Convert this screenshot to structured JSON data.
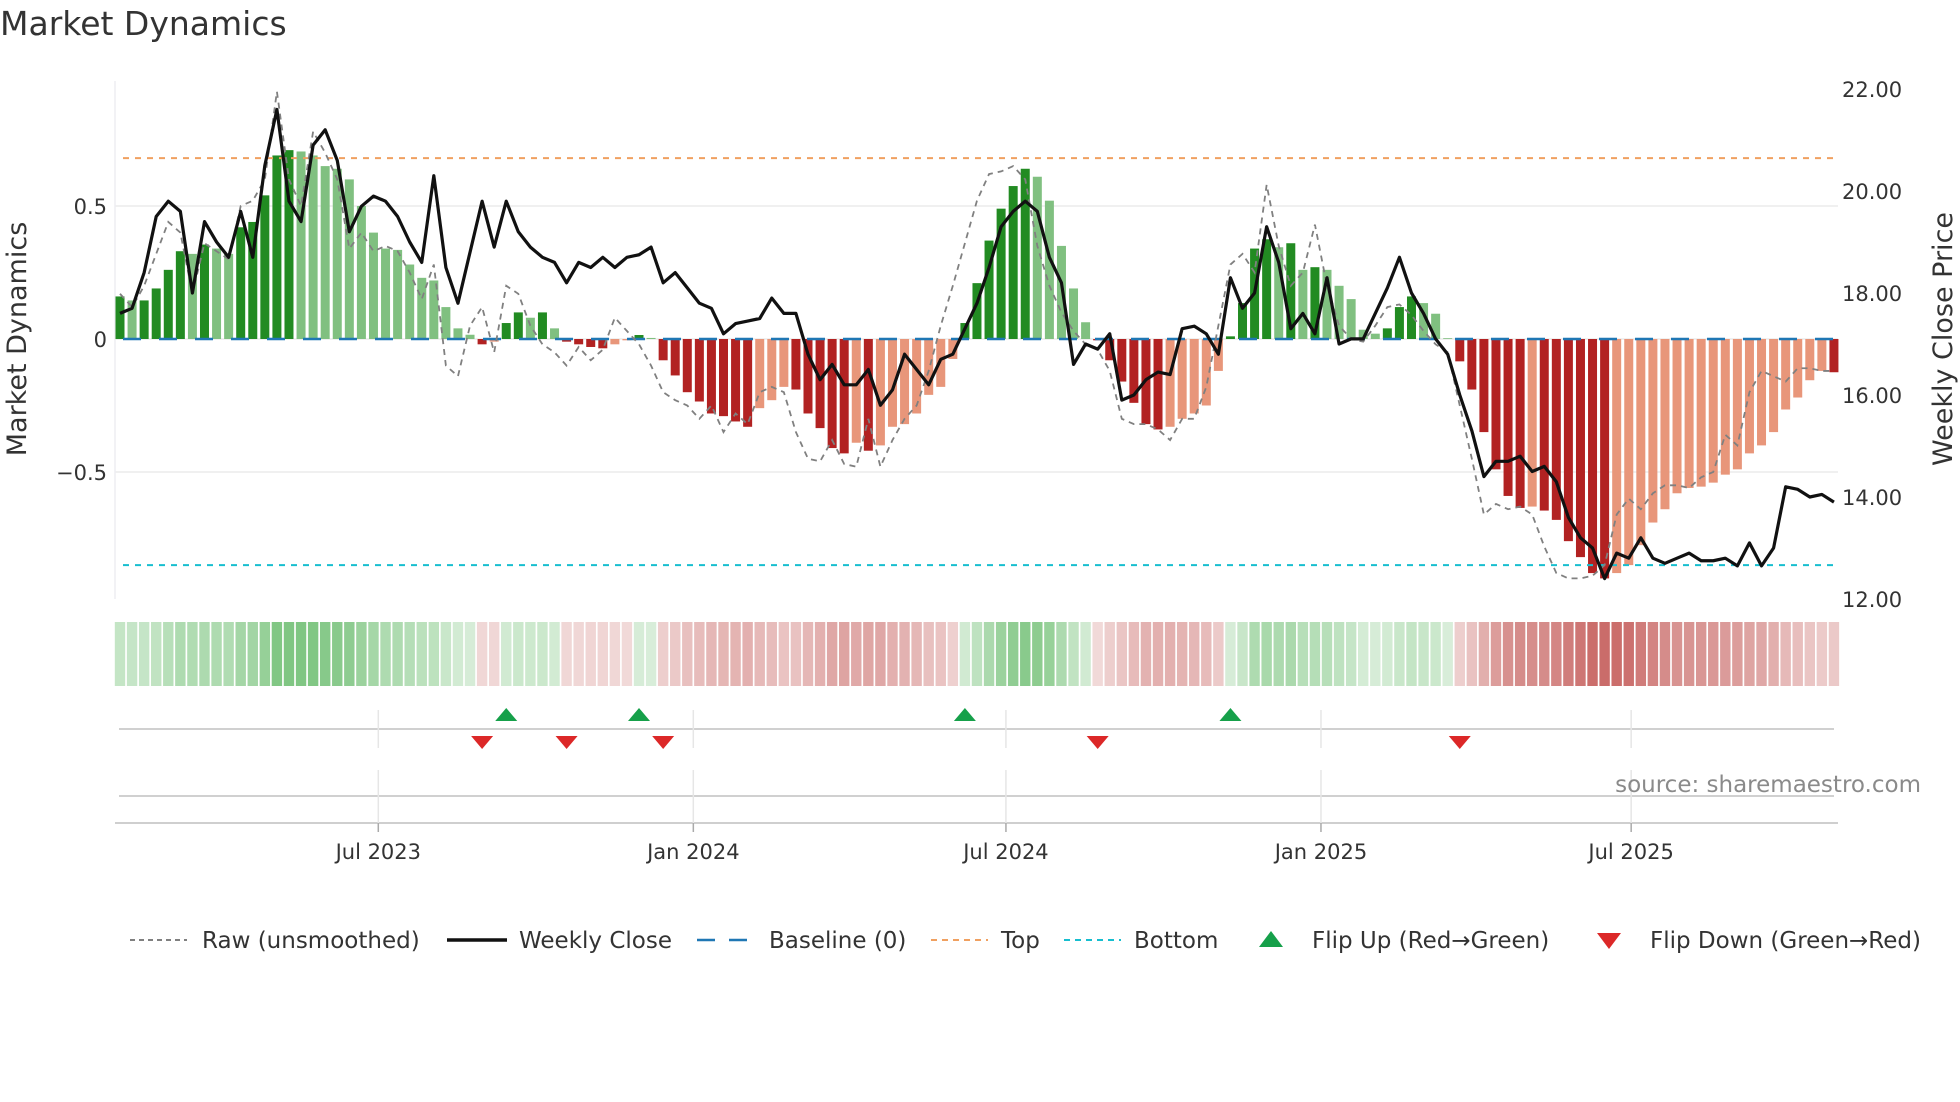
{
  "title": "Market Dynamics",
  "source": "source: sharemaestro.com",
  "chart_data": {
    "type": "bar",
    "title": "Market Dynamics",
    "ylabel": "Market Dynamics",
    "y2label": "Weekly Close Price",
    "ylim": [
      -0.97,
      0.97
    ],
    "y2lim": [
      12.0,
      22.0
    ],
    "yticks": [
      {
        "v": 0.5,
        "label": "0.5"
      },
      {
        "v": 0,
        "label": "0"
      },
      {
        "v": -0.5,
        "label": "−0.5"
      }
    ],
    "y2ticks": [
      {
        "v": 22,
        "label": "22.00"
      },
      {
        "v": 20,
        "label": "20.00"
      },
      {
        "v": 18,
        "label": "18.00"
      },
      {
        "v": 16,
        "label": "16.00"
      },
      {
        "v": 14,
        "label": "14.00"
      },
      {
        "v": 12,
        "label": "12.00"
      }
    ],
    "xticks": [
      {
        "week": 21.4,
        "label": "Jul 2023"
      },
      {
        "week": 47.5,
        "label": "Jan 2024"
      },
      {
        "week": 73.4,
        "label": "Jul 2024"
      },
      {
        "week": 99.5,
        "label": "Jan 2025"
      },
      {
        "week": 125.2,
        "label": "Jul 2025"
      }
    ],
    "top_level": 0.68,
    "bottom_level": -0.85,
    "baseline": 0,
    "dynamics": [
      0.16,
      0.145,
      0.145,
      0.19,
      0.26,
      0.33,
      0.32,
      0.355,
      0.34,
      0.32,
      0.42,
      0.44,
      0.54,
      0.69,
      0.71,
      0.705,
      0.69,
      0.65,
      0.64,
      0.6,
      0.5,
      0.4,
      0.34,
      0.335,
      0.28,
      0.23,
      0.22,
      0.12,
      0.04,
      0.016,
      -0.02,
      -0.01,
      0.06,
      0.1,
      0.08,
      0.1,
      0.04,
      -0.01,
      -0.02,
      -0.03,
      -0.035,
      -0.02,
      -0.005,
      0.015,
      0.004,
      -0.08,
      -0.137,
      -0.2,
      -0.235,
      -0.28,
      -0.29,
      -0.31,
      -0.33,
      -0.26,
      -0.23,
      -0.18,
      -0.19,
      -0.28,
      -0.335,
      -0.41,
      -0.43,
      -0.39,
      -0.42,
      -0.4,
      -0.33,
      -0.32,
      -0.28,
      -0.21,
      -0.18,
      -0.075,
      0.06,
      0.21,
      0.37,
      0.49,
      0.575,
      0.64,
      0.61,
      0.52,
      0.35,
      0.19,
      0.063,
      -0.005,
      -0.08,
      -0.16,
      -0.24,
      -0.32,
      -0.34,
      -0.33,
      -0.3,
      -0.28,
      -0.25,
      -0.12,
      0.01,
      0.135,
      0.34,
      0.375,
      0.345,
      0.36,
      0.26,
      0.27,
      0.26,
      0.2,
      0.15,
      0.035,
      0.02,
      0.04,
      0.12,
      0.16,
      0.135,
      0.095,
      0.003,
      -0.084,
      -0.19,
      -0.35,
      -0.49,
      -0.59,
      -0.635,
      -0.63,
      -0.645,
      -0.68,
      -0.76,
      -0.82,
      -0.88,
      -0.9,
      -0.88,
      -0.85,
      -0.775,
      -0.69,
      -0.64,
      -0.58,
      -0.56,
      -0.555,
      -0.54,
      -0.51,
      -0.49,
      -0.43,
      -0.4,
      -0.35,
      -0.265,
      -0.22,
      -0.155,
      -0.12,
      -0.125
    ],
    "raw": [
      0.17,
      0.12,
      0.2,
      0.32,
      0.44,
      0.4,
      0.17,
      0.36,
      0.33,
      0.3,
      0.5,
      0.52,
      0.6,
      0.93,
      0.6,
      0.5,
      0.78,
      0.7,
      0.6,
      0.34,
      0.4,
      0.33,
      0.35,
      0.33,
      0.25,
      0.15,
      0.28,
      -0.1,
      -0.14,
      0.05,
      0.12,
      -0.05,
      0.2,
      0.17,
      0.05,
      -0.02,
      -0.05,
      -0.1,
      -0.03,
      -0.08,
      -0.04,
      0.08,
      0.03,
      -0.02,
      -0.1,
      -0.2,
      -0.23,
      -0.25,
      -0.3,
      -0.25,
      -0.35,
      -0.28,
      -0.32,
      -0.2,
      -0.18,
      -0.2,
      -0.35,
      -0.45,
      -0.46,
      -0.38,
      -0.47,
      -0.48,
      -0.3,
      -0.48,
      -0.38,
      -0.3,
      -0.25,
      -0.12,
      0.05,
      0.2,
      0.36,
      0.52,
      0.62,
      0.63,
      0.65,
      0.6,
      0.35,
      0.2,
      0.1,
      0.03,
      -0.02,
      -0.04,
      -0.12,
      -0.3,
      -0.32,
      -0.32,
      -0.34,
      -0.38,
      -0.3,
      -0.3,
      -0.18,
      0.05,
      0.28,
      0.32,
      0.25,
      0.58,
      0.35,
      0.2,
      0.25,
      0.43,
      0.2,
      0.05,
      0.0,
      -0.01,
      0.05,
      0.12,
      0.13,
      0.09,
      0.03,
      -0.02,
      -0.05,
      -0.25,
      -0.45,
      -0.66,
      -0.62,
      -0.64,
      -0.63,
      -0.66,
      -0.78,
      -0.88,
      -0.9,
      -0.9,
      -0.89,
      -0.85,
      -0.66,
      -0.6,
      -0.64,
      -0.58,
      -0.55,
      -0.55,
      -0.56,
      -0.52,
      -0.5,
      -0.36,
      -0.4,
      -0.2,
      -0.12,
      -0.14,
      -0.16,
      -0.11,
      -0.11,
      -0.12,
      -0.12
    ],
    "weekly_close": [
      17.6,
      17.7,
      18.4,
      19.5,
      19.8,
      19.6,
      18.0,
      19.4,
      19.0,
      18.7,
      19.6,
      18.7,
      20.5,
      21.6,
      19.8,
      19.4,
      20.9,
      21.2,
      20.6,
      19.2,
      19.7,
      19.9,
      19.8,
      19.5,
      19.0,
      18.6,
      20.3,
      18.5,
      17.8,
      18.8,
      19.8,
      18.9,
      19.8,
      19.2,
      18.9,
      18.7,
      18.6,
      18.2,
      18.6,
      18.5,
      18.7,
      18.5,
      18.7,
      18.75,
      18.9,
      18.2,
      18.4,
      18.1,
      17.8,
      17.7,
      17.2,
      17.4,
      17.45,
      17.5,
      17.9,
      17.6,
      17.6,
      16.8,
      16.3,
      16.6,
      16.2,
      16.2,
      16.5,
      15.8,
      16.1,
      16.8,
      16.5,
      16.2,
      16.7,
      16.8,
      17.3,
      17.8,
      18.5,
      19.3,
      19.6,
      19.8,
      19.6,
      18.7,
      18.2,
      16.6,
      17.0,
      16.9,
      17.2,
      15.9,
      16.0,
      16.3,
      16.45,
      16.4,
      17.3,
      17.35,
      17.2,
      16.8,
      18.3,
      17.7,
      18.0,
      19.3,
      18.6,
      17.3,
      17.6,
      17.2,
      18.3,
      17.0,
      17.1,
      17.1,
      17.6,
      18.1,
      18.7,
      18.0,
      17.6,
      17.1,
      16.8,
      16.0,
      15.3,
      14.4,
      14.7,
      14.7,
      14.8,
      14.5,
      14.6,
      14.3,
      13.6,
      13.2,
      13.0,
      12.4,
      12.9,
      12.8,
      13.2,
      12.8,
      12.7,
      12.8,
      12.9,
      12.75,
      12.75,
      12.8,
      12.65,
      13.1,
      12.65,
      13.0,
      14.2,
      14.15,
      14.0,
      14.05,
      13.9
    ],
    "flips_up": [
      32,
      43,
      70,
      92
    ],
    "flips_down": [
      30,
      37,
      45,
      81,
      111
    ],
    "legend": {
      "position": "bottom",
      "items": [
        {
          "key": "raw",
          "label": "Raw (unsmoothed)"
        },
        {
          "key": "close",
          "label": "Weekly Close"
        },
        {
          "key": "baseline",
          "label": "Baseline (0)"
        },
        {
          "key": "top",
          "label": "Top"
        },
        {
          "key": "bottom",
          "label": "Bottom"
        },
        {
          "key": "flipup",
          "label": "Flip Up (Red→Green)"
        },
        {
          "key": "flipdown",
          "label": "Flip Down (Green→Red)"
        }
      ]
    },
    "colors": {
      "green_dark": "#228b22",
      "green_light": "#80c080",
      "red_dark": "#b22222",
      "red_light": "#e8967a",
      "raw": "#808080",
      "close": "#111111",
      "baseline": "#1f77b4",
      "top": "#f0a060",
      "bottom": "#17becf",
      "flip_up": "#16a04a",
      "flip_down": "#dc2828",
      "strip_green": "76,175,80",
      "strip_red": "192,80,77"
    }
  }
}
